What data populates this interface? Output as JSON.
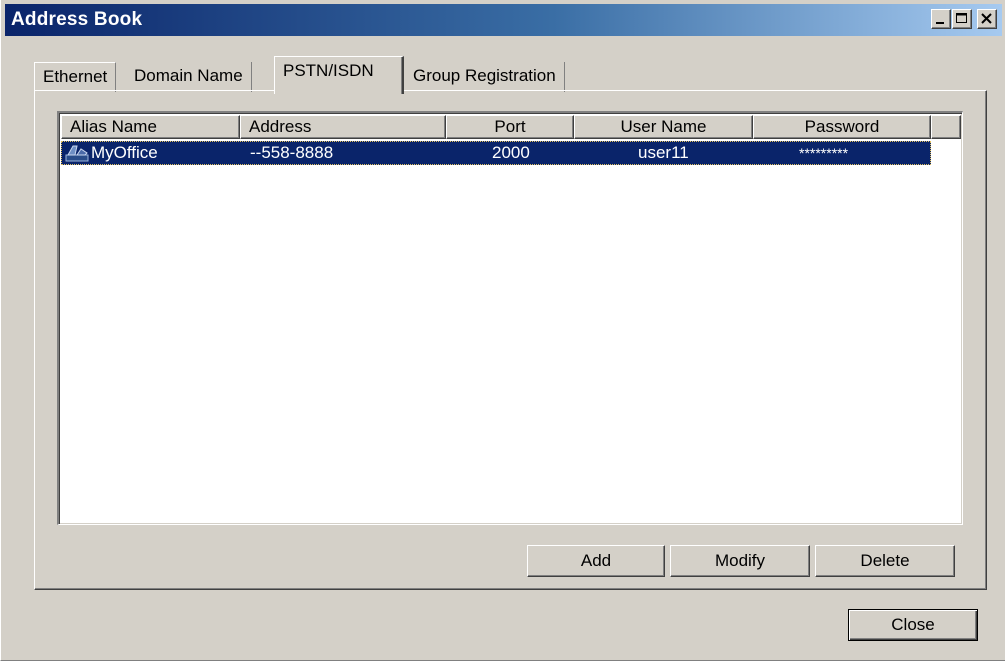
{
  "window": {
    "title": "Address Book",
    "controls": {
      "minimize_icon": "minimize-icon",
      "maximize_icon": "maximize-icon",
      "close_icon": "close-icon"
    }
  },
  "tabs": [
    {
      "label": "Ethernet",
      "active": false
    },
    {
      "label": "Domain Name",
      "active": false
    },
    {
      "label": "PSTN/ISDN",
      "active": true
    },
    {
      "label": "Group Registration",
      "active": false
    }
  ],
  "list": {
    "columns": [
      "Alias Name",
      "Address",
      "Port",
      "User Name",
      "Password"
    ],
    "rows": [
      {
        "icon": "phone-entry-icon",
        "alias": "MyOffice",
        "address": "--558-8888",
        "port": "2000",
        "user": "user11",
        "password": "*********",
        "selected": true
      }
    ]
  },
  "buttons": {
    "add": "Add",
    "modify": "Modify",
    "delete": "Delete",
    "close": "Close"
  },
  "colors": {
    "selection": "#0a246a",
    "face": "#d4d0c8",
    "title_gradient_start": "#0a246a",
    "title_gradient_end": "#a6caf0"
  }
}
